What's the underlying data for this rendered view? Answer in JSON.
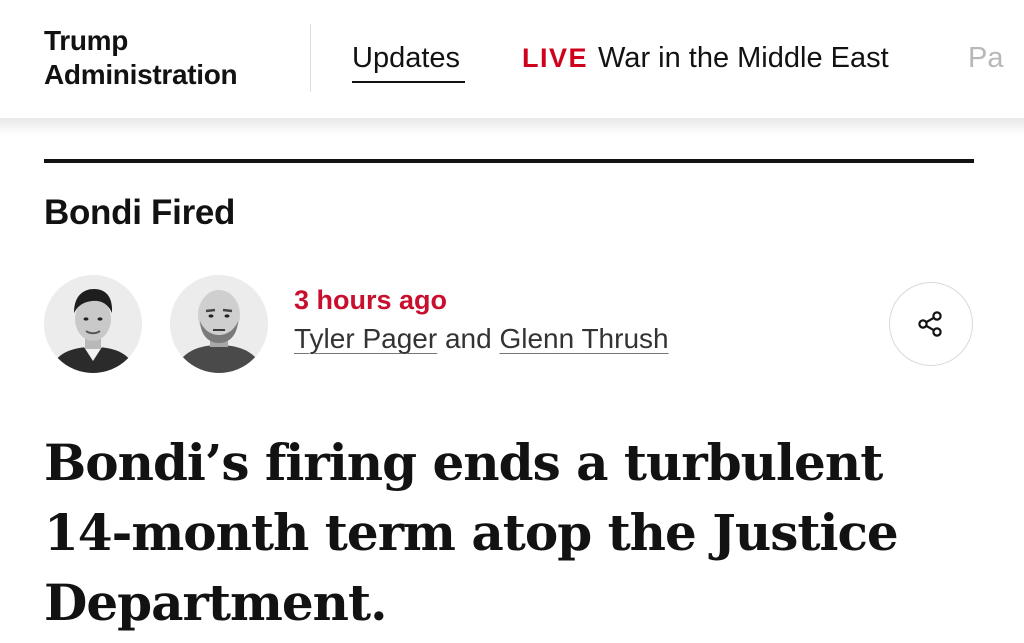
{
  "nav": {
    "section_title": "Trump\nAdministration",
    "links": {
      "updates": "Updates",
      "live_tag": "LIVE",
      "live_label": "War in the Middle East",
      "next_partial": "Pa"
    }
  },
  "article": {
    "kicker": "Bondi Fired",
    "timestamp": "3 hours ago",
    "byline": {
      "author_1": "Tyler Pager",
      "separator": "and",
      "author_2": "Glenn Thrush"
    },
    "headline": "Bondi’s firing ends a turbulent 14-month term atop the Justice Department."
  },
  "icons": {
    "share": "share-icon"
  },
  "colors": {
    "live_red": "#d0021b",
    "timestamp_red": "#c8102e",
    "text": "#121212"
  }
}
